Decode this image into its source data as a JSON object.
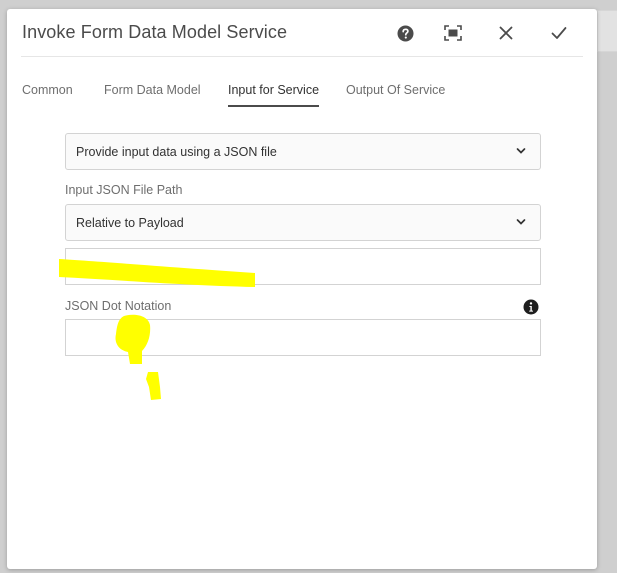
{
  "dialog": {
    "title": "Invoke Form Data Model Service",
    "header_buttons": {
      "help_icon": "help-icon",
      "fullscreen_icon": "fullscreen-icon",
      "close_icon": "close-icon",
      "done_icon": "checkmark-icon"
    }
  },
  "tabs": [
    {
      "label": "Common",
      "active": false
    },
    {
      "label": "Form Data Model",
      "active": false
    },
    {
      "label": "Input for Service",
      "active": true
    },
    {
      "label": "Output Of Service",
      "active": false
    }
  ],
  "input_for_service": {
    "mode_select": {
      "value": "Provide input data using a JSON file"
    },
    "file_path_label": "Input JSON File Path",
    "file_path_select": {
      "value": "Relative to Payload"
    },
    "file_path_input": {
      "value": ""
    },
    "dot_notation_label": "JSON Dot Notation",
    "dot_notation_input": {
      "value": ""
    }
  },
  "colors": {
    "highlight": "#ffff00",
    "text_primary": "#323232",
    "text_secondary": "#6e6e6e",
    "border": "#d3d3d3"
  }
}
